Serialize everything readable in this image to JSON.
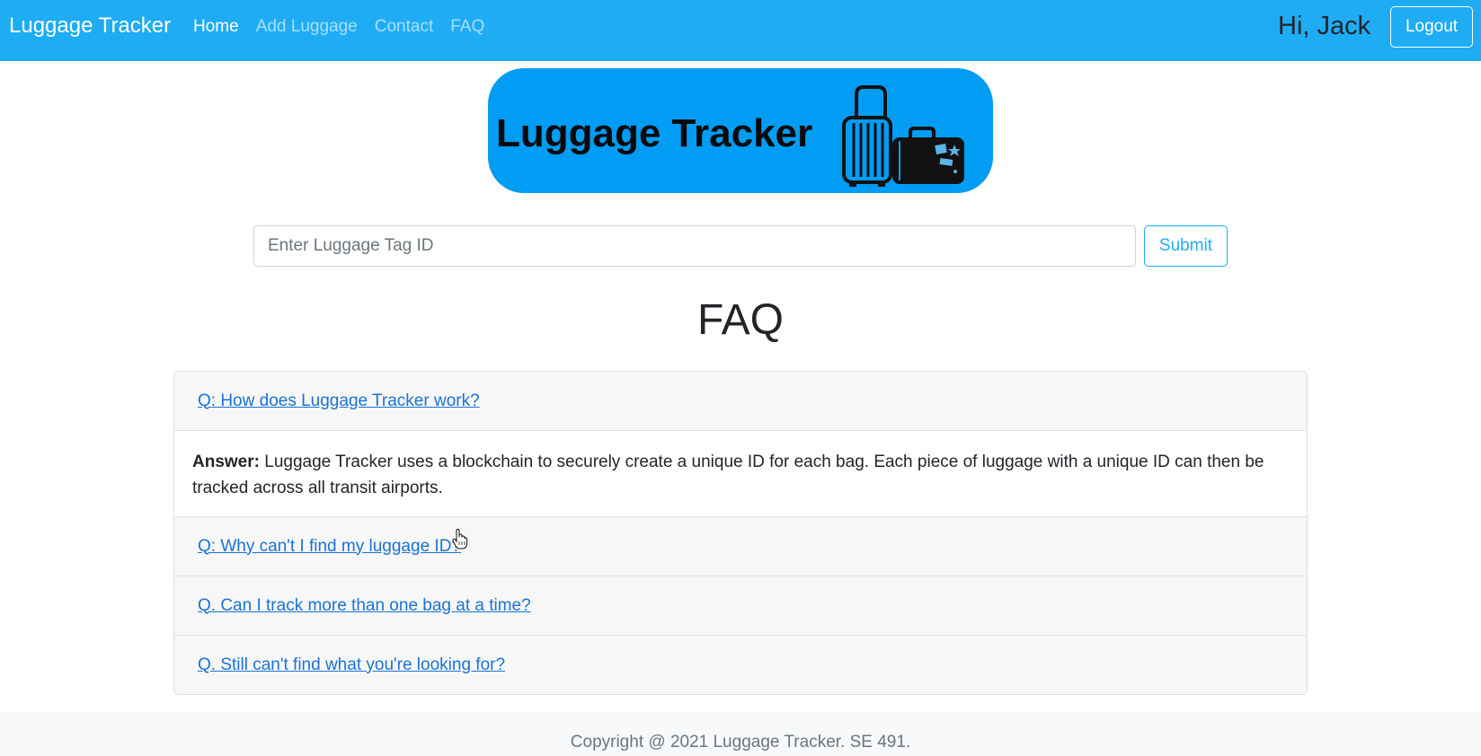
{
  "navbar": {
    "brand": "Luggage Tracker",
    "links": [
      {
        "label": "Home",
        "active": true
      },
      {
        "label": "Add Luggage",
        "active": false
      },
      {
        "label": "Contact",
        "active": false
      },
      {
        "label": "FAQ",
        "active": false
      }
    ],
    "greeting": "Hi, Jack",
    "logout_label": "Logout"
  },
  "banner": {
    "title": "Luggage Tracker"
  },
  "search": {
    "placeholder": "Enter Luggage Tag ID",
    "value": "",
    "submit_label": "Submit"
  },
  "faq": {
    "title": "FAQ",
    "items": [
      {
        "question": "Q: How does Luggage Tracker work?"
      },
      {
        "question": "Q: Why can't I find my luggage ID?"
      },
      {
        "question": "Q. Can I track more than one bag at a time?"
      },
      {
        "question": "Q. Still can't find what you're looking for?"
      }
    ],
    "answer_label": "Answer:",
    "answer_text": " Luggage Tracker uses a blockchain to securely create a unique ID for each bag. Each piece of luggage with a unique ID can then be tracked across all transit airports."
  },
  "footer": {
    "text": "Copyright @ 2021 Luggage Tracker. SE 491."
  },
  "colors": {
    "navbar": "#1eacf5",
    "banner": "#019cf3",
    "link": "#1a73d6"
  },
  "icons": [
    "luggage-icon",
    "hand-pointer-cursor-icon"
  ]
}
